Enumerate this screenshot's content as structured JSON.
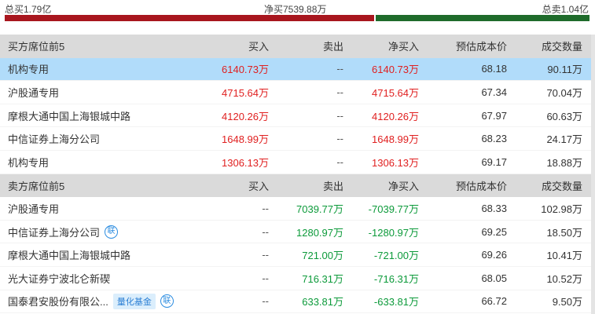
{
  "summary": {
    "total_buy": "总买1.79亿",
    "net_buy": "净买7539.88万",
    "total_sell": "总卖1.04亿",
    "buy_fraction": 0.632,
    "colors": {
      "buy": "#a8161e",
      "sell": "#1f6b2b"
    }
  },
  "buyers": {
    "headers": [
      "买方席位前5",
      "买入",
      "卖出",
      "净买入",
      "预估成本价",
      "成交数量"
    ],
    "rows": [
      {
        "name": "机构专用",
        "buy": "6140.73万",
        "sell": "--",
        "net": "6140.73万",
        "cost": "68.18",
        "volume": "90.11万"
      },
      {
        "name": "沪股通专用",
        "buy": "4715.64万",
        "sell": "--",
        "net": "4715.64万",
        "cost": "67.34",
        "volume": "70.04万"
      },
      {
        "name": "摩根大通中国上海银城中路",
        "buy": "4120.26万",
        "sell": "--",
        "net": "4120.26万",
        "cost": "67.97",
        "volume": "60.63万"
      },
      {
        "name": "中信证券上海分公司",
        "buy": "1648.99万",
        "sell": "--",
        "net": "1648.99万",
        "cost": "68.23",
        "volume": "24.17万"
      },
      {
        "name": "机构专用",
        "buy": "1306.13万",
        "sell": "--",
        "net": "1306.13万",
        "cost": "69.17",
        "volume": "18.88万"
      }
    ]
  },
  "sellers": {
    "headers": [
      "卖方席位前5",
      "买入",
      "卖出",
      "净买入",
      "预估成本价",
      "成交数量"
    ],
    "rows": [
      {
        "name": "沪股通专用",
        "buy": "--",
        "sell": "7039.77万",
        "net": "-7039.77万",
        "cost": "68.33",
        "volume": "102.98万"
      },
      {
        "name": "中信证券上海分公司",
        "lian": "联",
        "buy": "--",
        "sell": "1280.97万",
        "net": "-1280.97万",
        "cost": "69.25",
        "volume": "18.50万"
      },
      {
        "name": "摩根大通中国上海银城中路",
        "buy": "--",
        "sell": "721.00万",
        "net": "-721.00万",
        "cost": "69.26",
        "volume": "10.41万"
      },
      {
        "name": "光大证券宁波北仑新碶",
        "buy": "--",
        "sell": "716.31万",
        "net": "-716.31万",
        "cost": "68.05",
        "volume": "10.52万"
      },
      {
        "name": "国泰君安股份有限公...",
        "tag": "量化基金",
        "lian": "联",
        "buy": "--",
        "sell": "633.81万",
        "net": "-633.81万",
        "cost": "66.72",
        "volume": "9.50万"
      }
    ]
  }
}
